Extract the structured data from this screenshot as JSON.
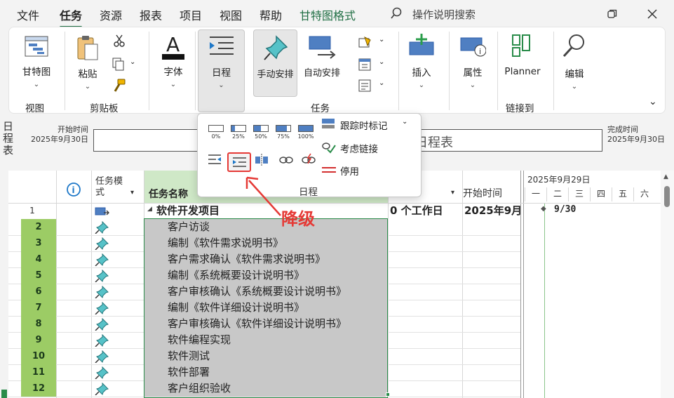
{
  "menubar": {
    "items": [
      "文件",
      "任务",
      "资源",
      "报表",
      "项目",
      "视图",
      "帮助",
      "甘特图格式"
    ],
    "active_index": 1,
    "search_placeholder": "操作说明搜索",
    "restore_icon": "restore-window-icon",
    "close_icon": "close-icon"
  },
  "ribbon": {
    "gantt_label": "甘特图",
    "paste_label": "粘贴",
    "font_label": "字体",
    "schedule_label": "日程",
    "manual_label": "手动安排",
    "auto_label": "自动安排",
    "insert_label": "插入",
    "properties_label": "属性",
    "planner_label": "Planner",
    "edit_label": "编辑",
    "groups": {
      "view": "视图",
      "clipboard": "剪贴板",
      "tasks": "任务",
      "link": "链接到"
    }
  },
  "dropdown": {
    "progress": [
      {
        "label": "0%",
        "fill": 0
      },
      {
        "label": "25%",
        "fill": 0.25
      },
      {
        "label": "50%",
        "fill": 0.5
      },
      {
        "label": "75%",
        "fill": 0.75
      },
      {
        "label": "100%",
        "fill": 1
      }
    ],
    "track_label": "跟踪时标记",
    "respect_links_label": "考虑链接",
    "deactivate_label": "停用",
    "group_label": "日程"
  },
  "annotation": {
    "text": "降级",
    "color": "#e53935"
  },
  "timeline": {
    "vertical_label": "日程表",
    "start_caption": "开始时间",
    "start_date": "2025年9月30日",
    "bar_text": "日程表",
    "finish_caption": "完成时间",
    "finish_date": "2025年9月30日"
  },
  "table": {
    "headers": {
      "info": "i",
      "mode": "任务模式",
      "name": "任务名称",
      "start": "开始时间"
    },
    "summary": {
      "id": "1",
      "name": "软件开发项目",
      "duration": "0 个工作日",
      "start": "2025年9月"
    },
    "tasks": [
      {
        "id": "2",
        "name": "客户访谈"
      },
      {
        "id": "3",
        "name": "编制《软件需求说明书》"
      },
      {
        "id": "4",
        "name": "客户需求确认《软件需求说明书》"
      },
      {
        "id": "5",
        "name": "编制《系统概要设计说明书》"
      },
      {
        "id": "6",
        "name": "客户审核确认《系统概要设计说明书》"
      },
      {
        "id": "7",
        "name": "编制《软件详细设计说明书》"
      },
      {
        "id": "8",
        "name": "客户审核确认《软件详细设计说明书》"
      },
      {
        "id": "9",
        "name": "软件编程实现"
      },
      {
        "id": "10",
        "name": "软件测试"
      },
      {
        "id": "11",
        "name": "软件部署"
      },
      {
        "id": "12",
        "name": "客户组织验收"
      }
    ]
  },
  "gantt": {
    "week_label": "2025年9月29日",
    "days": [
      "一",
      "二",
      "三",
      "四",
      "五",
      "六"
    ],
    "milestone_label": "9/30"
  },
  "colors": {
    "accent": "#1f6e43",
    "row_selected": "#c8c8c8",
    "id_selected": "#9ccc65"
  }
}
